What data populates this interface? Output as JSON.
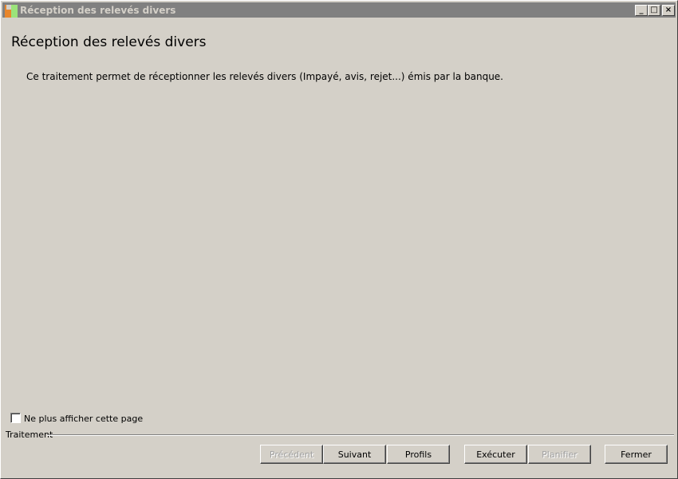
{
  "window": {
    "title": "Réception des relevés divers",
    "controls": {
      "minimize": "_",
      "maximize": "□",
      "close": "×"
    }
  },
  "page": {
    "heading": "Réception des relevés divers",
    "description": "Ce traitement permet de réceptionner les relevés divers (Impayé, avis, rejet...) émis par la banque."
  },
  "options": {
    "dont_show_again": {
      "label": "Ne plus afficher cette page",
      "checked": false
    }
  },
  "footer": {
    "section_label": "Traitement",
    "buttons": {
      "precedent": {
        "label": "Précédent",
        "enabled": false
      },
      "suivant": {
        "label": "Suivant",
        "enabled": true
      },
      "profils": {
        "label": "Profils",
        "enabled": true
      },
      "executer": {
        "label": "Exécuter",
        "enabled": true
      },
      "planifier": {
        "label": "Planifier",
        "enabled": false
      },
      "fermer": {
        "label": "Fermer",
        "enabled": true
      }
    }
  }
}
